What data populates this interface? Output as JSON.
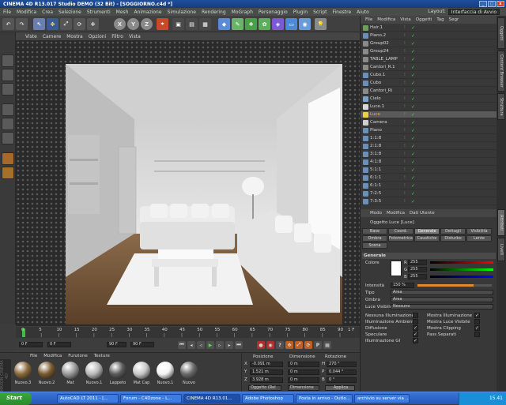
{
  "window": {
    "title": "CINEMA 4D R13.017 Studio DEMO (32 Bit) - [SOGGIORNO.c4d *]"
  },
  "menu": {
    "items": [
      "File",
      "Modifica",
      "Crea",
      "Selezione",
      "Strumenti",
      "Mesh",
      "Animazione",
      "Simulazione",
      "Rendering",
      "MoGraph",
      "Personaggio",
      "Plugin",
      "Script",
      "Finestre",
      "Aiuto"
    ],
    "layout_label": "Layout:",
    "layout_value": "Interfaccia di Avvio"
  },
  "toolbar": {
    "axis_x": "X",
    "axis_y": "Y",
    "axis_z": "Z"
  },
  "viewport": {
    "menu": [
      "Viste",
      "Camere",
      "Mostra",
      "Opzioni",
      "Filtro",
      "Vista"
    ]
  },
  "timeline": {
    "ticks": [
      "0",
      "5",
      "10",
      "15",
      "20",
      "25",
      "30",
      "35",
      "40",
      "45",
      "50",
      "55",
      "60",
      "65",
      "70",
      "75",
      "80",
      "85",
      "90"
    ],
    "current_frame": "0 F",
    "end_frame_label": "1 F",
    "start_field": "0 F",
    "min_field": "0 F",
    "max_field": "90 F",
    "end_field": "90 F"
  },
  "materials": {
    "menu": [
      "File",
      "Modifica",
      "Funzione",
      "Texture"
    ],
    "items": [
      {
        "name": "Nuovo.3",
        "color": "#8a6a3a"
      },
      {
        "name": "Nuovo.2",
        "color": "#7a5a30"
      },
      {
        "name": "Mat",
        "color": "#9a9a9a"
      },
      {
        "name": "Nuovo.1",
        "color": "#b9b9b9"
      },
      {
        "name": "Lappeto",
        "color": "#5a5a5a"
      },
      {
        "name": "Mat Cap",
        "color": "#c8c8c8"
      },
      {
        "name": "Nuovo.1",
        "color": "#f4f4f4"
      },
      {
        "name": "Nuovo",
        "color": "#6a6a6a"
      }
    ],
    "brand": "MAXON CINEMA 4D"
  },
  "coordinates": {
    "headers": [
      "Posizione",
      "Dimensione",
      "Rotazione"
    ],
    "rows": [
      {
        "axis": "X",
        "pos": "-0.091 m",
        "dim": "0 m",
        "rot": "H",
        "rotval": "270 °"
      },
      {
        "axis": "Y",
        "pos": "1.521 m",
        "dim": "0 m",
        "rot": "P",
        "rotval": "0.044 °"
      },
      {
        "axis": "Z",
        "pos": "3.928 m",
        "dim": "0 m",
        "rot": "B",
        "rotval": "0 °"
      }
    ],
    "mode": "Oggetto (Rel",
    "dim_mode": "Dimensione",
    "apply": "Applica"
  },
  "object_manager": {
    "menu": [
      "File",
      "Modifica",
      "Vista",
      "Oggetti",
      "Tag",
      "Segr"
    ],
    "objects": [
      {
        "name": "Hair.1",
        "color": "#6d9f5a"
      },
      {
        "name": "Piano.2",
        "color": "#6a8fb8"
      },
      {
        "name": "Group02",
        "color": "#8a8a8a"
      },
      {
        "name": "Group24",
        "color": "#8a8a8a"
      },
      {
        "name": "TABLE_LAMP",
        "color": "#8a8a8a"
      },
      {
        "name": "Cantori_R.1",
        "color": "#8a8a8a"
      },
      {
        "name": "Cubo.1",
        "color": "#6a8fb8"
      },
      {
        "name": "Cubo",
        "color": "#6a8fb8"
      },
      {
        "name": "Cantori_Ri",
        "color": "#8a8a8a"
      },
      {
        "name": "Cielo",
        "color": "#7aa2c8"
      },
      {
        "name": "Luce.1",
        "color": "#d8d8d8"
      },
      {
        "name": "Luce",
        "color": "#f0d040"
      },
      {
        "name": "Camera",
        "color": "#cfcfcf"
      },
      {
        "name": "Piano",
        "color": "#6a8fb8"
      },
      {
        "name": "1:1:8",
        "color": "#6a8fb8"
      },
      {
        "name": "2:1:8",
        "color": "#6a8fb8"
      },
      {
        "name": "3:1:8",
        "color": "#6a8fb8"
      },
      {
        "name": "4:1:8",
        "color": "#6a8fb8"
      },
      {
        "name": "5:1:1",
        "color": "#6a8fb8"
      },
      {
        "name": "6:1:1",
        "color": "#6a8fb8"
      },
      {
        "name": "6:1:1",
        "color": "#6a8fb8"
      },
      {
        "name": "7:2:5",
        "color": "#6a8fb8"
      },
      {
        "name": "7:3:5",
        "color": "#6a8fb8"
      }
    ]
  },
  "attributes": {
    "menu": [
      "Modo",
      "Modifica",
      "Dati Utente"
    ],
    "object_title": "Oggetto Luce [Luce]",
    "tabs_row1": [
      "Base",
      "Coord.",
      "Generale",
      "Dettagli",
      "Visibilità"
    ],
    "tabs_row2": [
      "Ombra",
      "Fotometrica",
      "Caustiche",
      "Disturbo",
      "Lente"
    ],
    "tabs_row3": [
      "Scena"
    ],
    "section": "Generale",
    "color_label": "Colore",
    "r": "255",
    "g": "255",
    "b": "255",
    "r_label": "R",
    "g_label": "G",
    "b_label": "B",
    "intensity_label": "Intensità",
    "intensity_value": "150 %",
    "type_label": "Tipo",
    "type_value": "Area",
    "shadow_label": "Ombra",
    "shadow_value": "Area",
    "visible_light_label": "Luce Visibile",
    "visible_light_value": "Nessuno",
    "checks_left": [
      {
        "label": "Nessuna Illuminazione",
        "checked": false
      },
      {
        "label": "Illuminazione Ambiente",
        "checked": false
      },
      {
        "label": "Diffusione",
        "checked": true
      },
      {
        "label": "Speculare",
        "checked": true
      },
      {
        "label": "Illuminazione GI",
        "checked": true
      }
    ],
    "checks_right": [
      {
        "label": "Mostra Illuminazione",
        "checked": true
      },
      {
        "label": "Mostra Luce Visibile",
        "checked": false
      },
      {
        "label": "Mostra Clipping",
        "checked": true
      },
      {
        "label": "Pass Separati",
        "checked": false
      }
    ]
  },
  "side_tabs": [
    "Oggetti",
    "Content Browser",
    "Struttura",
    "Attributi",
    "Livelli"
  ],
  "taskbar": {
    "start": "Start",
    "items": [
      "AutoCAD LT 2011 - [...",
      "Forum - C4Dzone - L...",
      "CINEMA 4D R13.01...",
      "Adobe Photoshop",
      "Posta in arrivo - Outlo...",
      "archivio su server via ..."
    ],
    "time": "15.41"
  }
}
